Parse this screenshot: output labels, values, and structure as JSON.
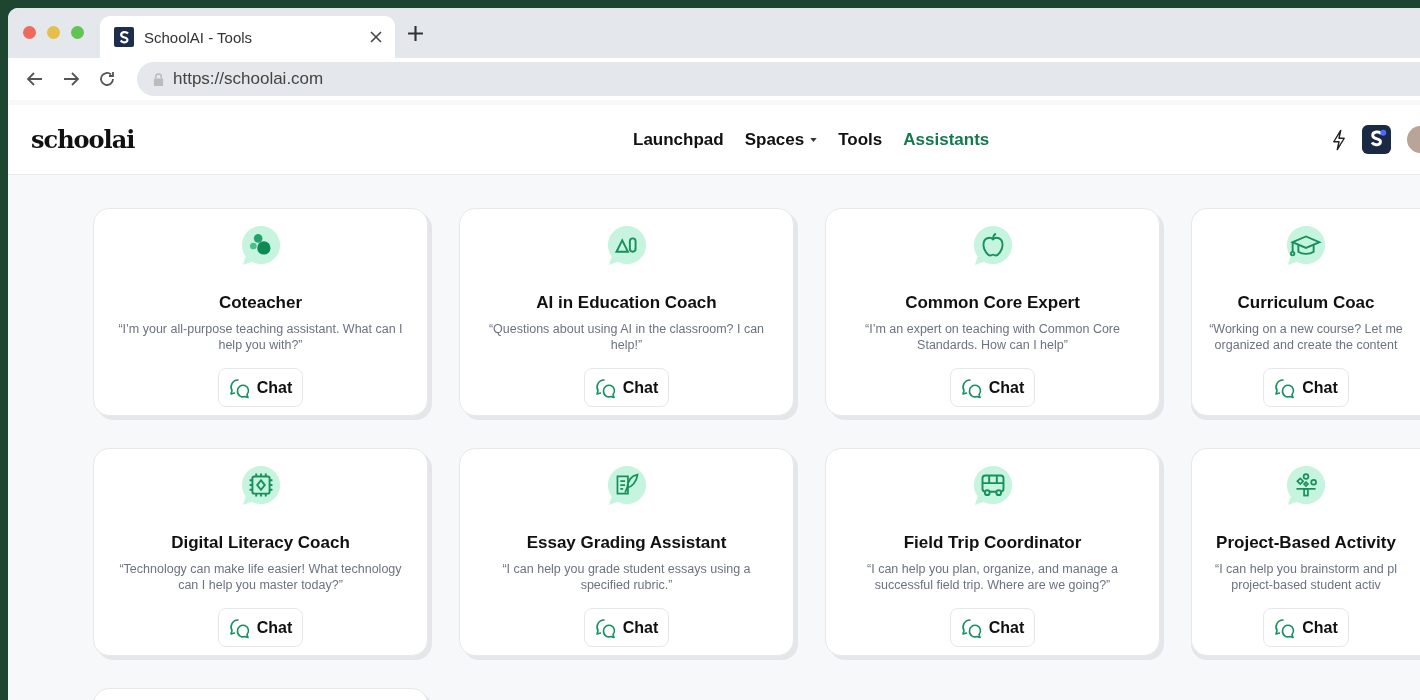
{
  "browser": {
    "tab_title": "SchoolAI - Tools",
    "url": "https://schoolai.com"
  },
  "app": {
    "logo": "schoolai",
    "nav": [
      {
        "label": "Launchpad",
        "selected": false,
        "dropdown": false
      },
      {
        "label": "Spaces",
        "selected": false,
        "dropdown": true
      },
      {
        "label": "Tools",
        "selected": false,
        "dropdown": false
      },
      {
        "label": "Assistants",
        "selected": true,
        "dropdown": false
      }
    ]
  },
  "assistants": [
    {
      "kind": "dots",
      "name": "Coteacher",
      "description": "“I’m your all-purpose teaching assistant. What can I help you with?”",
      "button": "Chat"
    },
    {
      "kind": "shapes",
      "name": "AI in Education Coach",
      "description": "“Questions about using AI in the classroom? I can help!”",
      "button": "Chat"
    },
    {
      "kind": "apple",
      "name": "Common Core Expert",
      "description": "“I’m an expert on teaching with Common Core Standards. How can I help”",
      "button": "Chat"
    },
    {
      "kind": "cap",
      "name": "Curriculum Coac",
      "description": "“Working on a new course? Let me organized and create the content",
      "button": "Chat"
    },
    {
      "kind": "chip",
      "name": "Digital Literacy Coach",
      "description": "“Technology can make life easier! What technology can I help you master today?”",
      "button": "Chat"
    },
    {
      "kind": "quill",
      "name": "Essay Grading Assistant",
      "description": "“I can help you grade student essays using a specified rubric.”",
      "button": "Chat"
    },
    {
      "kind": "bus",
      "name": "Field Trip Coordinator",
      "description": "“I can help you plan, organize, and manage a successful field trip. Where are we going?”",
      "button": "Chat"
    },
    {
      "kind": "tree",
      "name": "Project-Based Activity",
      "description": "“I can help you brainstorm and pl project-based student activ",
      "button": "Chat"
    }
  ]
}
